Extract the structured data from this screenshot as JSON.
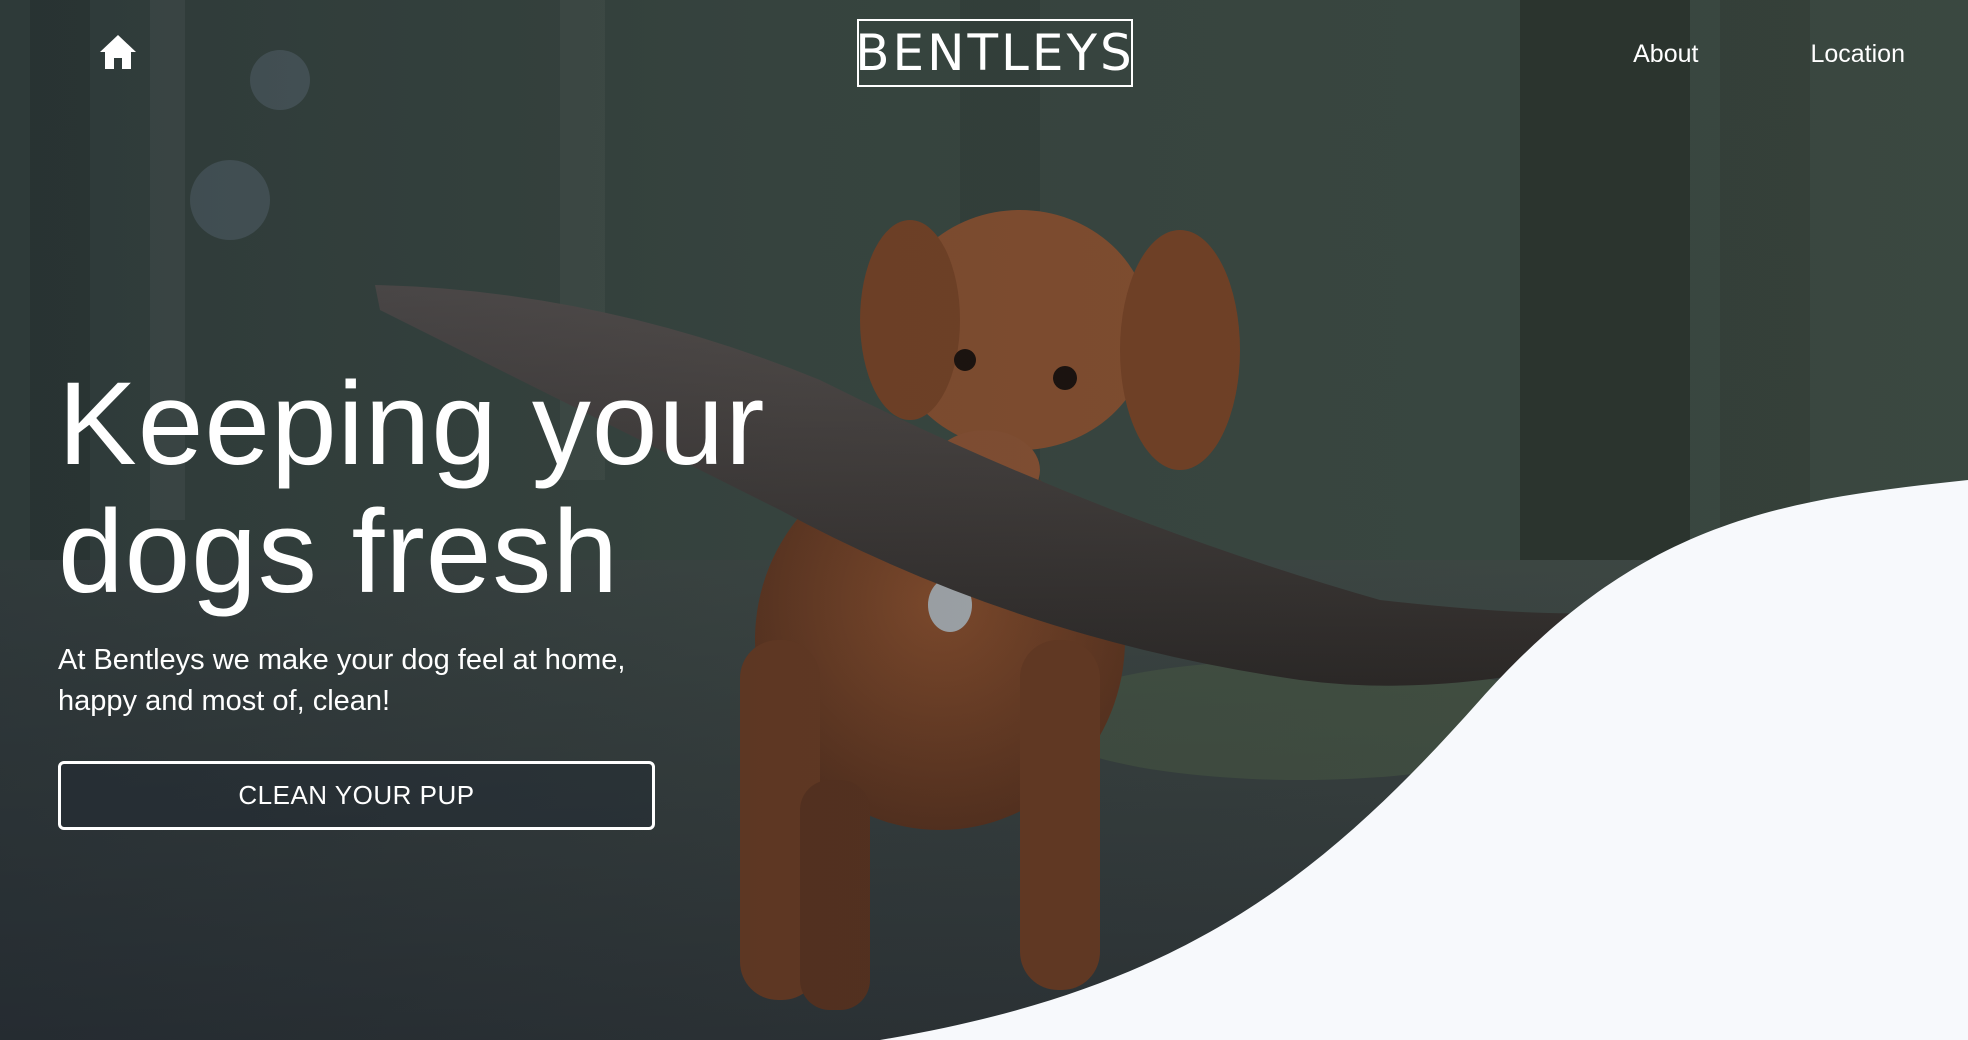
{
  "nav": {
    "home_icon": "home-icon",
    "brand": "BENTLEYS",
    "links": [
      "About",
      "Location"
    ]
  },
  "hero": {
    "headline_line1": "Keeping your",
    "headline_line2": "dogs fresh",
    "subtext": "At Bentleys we make your dog feel at home, happy and most of, clean!",
    "cta_label": "CLEAN YOUR PUP"
  },
  "colors": {
    "text": "#ffffff",
    "wave": "#f7f9fc",
    "overlay": "#1c2430"
  }
}
